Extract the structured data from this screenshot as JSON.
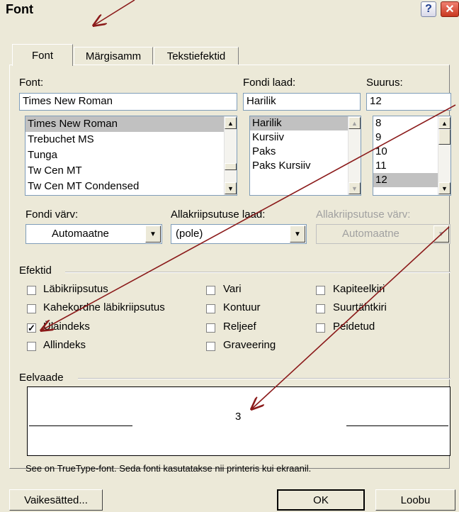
{
  "window": {
    "title": "Font"
  },
  "tabs": [
    {
      "label": "Font",
      "active": true
    },
    {
      "label": "Märgisamm",
      "active": false
    },
    {
      "label": "Tekstiefektid",
      "active": false
    }
  ],
  "font": {
    "label": "Font:",
    "value": "Times New Roman",
    "items": [
      "Times New Roman",
      "Trebuchet MS",
      "Tunga",
      "Tw Cen MT",
      "Tw Cen MT Condensed"
    ],
    "selected": "Times New Roman"
  },
  "style": {
    "label": "Fondi laad:",
    "value": "Harilik",
    "items": [
      "Harilik",
      "Kursiiv",
      "Paks",
      "Paks Kursiiv"
    ],
    "selected": "Harilik"
  },
  "size": {
    "label": "Suurus:",
    "value": "12",
    "items": [
      "8",
      "9",
      "10",
      "11",
      "12"
    ],
    "selected": "12"
  },
  "font_color": {
    "label": "Fondi värv:",
    "value": "Automaatne"
  },
  "underline_style": {
    "label": "Allakriipsutuse laad:",
    "value": "(pole)"
  },
  "underline_color": {
    "label": "Allakriipsutuse värv:",
    "value": "Automaatne"
  },
  "effects": {
    "label": "Efektid",
    "items": [
      {
        "label": "Läbikriipsutus",
        "checked": false
      },
      {
        "label": "Kahekordne läbikriipsutus",
        "checked": false
      },
      {
        "label": "Ülaindeks",
        "checked": true
      },
      {
        "label": "Allindeks",
        "checked": false
      },
      {
        "label": "Vari",
        "checked": false
      },
      {
        "label": "Kontuur",
        "checked": false
      },
      {
        "label": "Reljeef",
        "checked": false
      },
      {
        "label": "Graveering",
        "checked": false
      },
      {
        "label": "Kapiteelkiri",
        "checked": false
      },
      {
        "label": "Suurtähtkiri",
        "checked": false
      },
      {
        "label": "Peidetud",
        "checked": false
      }
    ]
  },
  "preview": {
    "label": "Eelvaade",
    "sample": "3",
    "note": "See on TrueType-font. Seda fonti kasutatakse nii printeris kui ekraanil."
  },
  "buttons": {
    "default": "Vaikesätted...",
    "ok": "OK",
    "cancel": "Loobu"
  },
  "colors": {
    "annotation_arrow": "#8b1a1a",
    "dialog_bg": "#ece9d8",
    "selection": "#c1c1c1"
  }
}
